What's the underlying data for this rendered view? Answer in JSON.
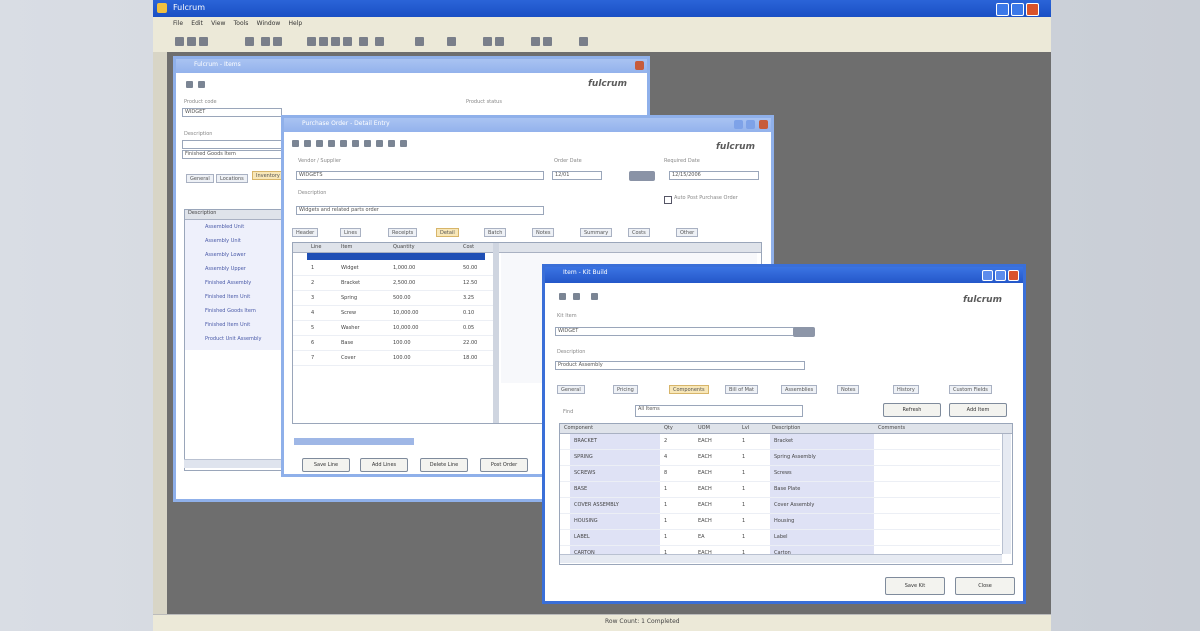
{
  "app": {
    "title": "Fulcrum",
    "menu": [
      "File",
      "Edit",
      "View",
      "Tools",
      "Window",
      "Help"
    ],
    "status": "Row Count: 1 Completed"
  },
  "window1": {
    "title": "Fulcrum - Items",
    "logo": "fulcrum",
    "labels": [
      "Product code",
      "Description",
      "Product status"
    ],
    "field_values": [
      "WIDGET",
      "",
      "Finished Goods Item"
    ],
    "tabs": [
      "General",
      "Locations",
      "Inventory"
    ],
    "list_header": "Description",
    "list_items": [
      "Assembled Unit",
      "Assembly Unit",
      "Assembly Lower",
      "Assembly Upper",
      "Finished Assembly",
      "Finished Item Unit",
      "Finished Goods Item",
      "Finished Item Unit",
      "Product Unit Assembly"
    ]
  },
  "window2": {
    "title": "Purchase Order - Detail Entry",
    "logo": "fulcrum",
    "labels": [
      "Vendor / Supplier",
      "Order Date",
      "Required Date",
      "Description"
    ],
    "field_values": [
      "WIDGETS",
      "12/01",
      "12/15/2006",
      "Widgets and related parts order"
    ],
    "checkbox": "Auto Post Purchase Order",
    "tabs": [
      "Header",
      "Lines",
      "Receipts",
      "Detail",
      "Batch",
      "Notes",
      "Summary",
      "Costs",
      "Other"
    ],
    "columns": [
      "Line",
      "Item",
      "Quantity",
      "Cost"
    ],
    "rows": [
      [
        "1",
        "Widget",
        "1,000.00",
        "50.00"
      ],
      [
        "2",
        "Bracket",
        "2,500.00",
        "12.50"
      ],
      [
        "3",
        "Spring",
        "500.00",
        "3.25"
      ],
      [
        "4",
        "Screw",
        "10,000.00",
        "0.10"
      ],
      [
        "5",
        "Washer",
        "10,000.00",
        "0.05"
      ],
      [
        "6",
        "Base",
        "100.00",
        "22.00"
      ],
      [
        "7",
        "Cover",
        "100.00",
        "18.00"
      ]
    ],
    "buttons": [
      "Save Line",
      "Add Lines",
      "Delete Line",
      "Post Order"
    ]
  },
  "window3": {
    "title": "Item - Kit Build",
    "logo": "fulcrum",
    "labels": [
      "Kit Item",
      "Description"
    ],
    "field_values": [
      "WIDGET",
      "Product Assembly"
    ],
    "tabs": [
      "General",
      "Pricing",
      "Components",
      "Bill of Mat",
      "Assemblies",
      "Notes",
      "History",
      "Custom Fields"
    ],
    "filter_label": "Find",
    "filter_value": "All Items",
    "filter_buttons": [
      "Refresh",
      "Add Item"
    ],
    "columns": [
      "Component",
      "Qty",
      "UOM",
      "Lvl",
      "Description",
      "Comments"
    ],
    "rows": [
      [
        "BRACKET",
        "2",
        "EACH",
        "1",
        "Bracket"
      ],
      [
        "SPRING",
        "4",
        "EACH",
        "1",
        "Spring Assembly"
      ],
      [
        "SCREWS",
        "8",
        "EACH",
        "1",
        "Screws"
      ],
      [
        "BASE",
        "1",
        "EACH",
        "1",
        "Base Plate"
      ],
      [
        "COVER ASSEMBLY",
        "1",
        "EACH",
        "1",
        "Cover Assembly"
      ],
      [
        "HOUSING",
        "1",
        "EACH",
        "1",
        "Housing"
      ],
      [
        "LABEL",
        "1",
        "EA",
        "1",
        "Label"
      ],
      [
        "CARTON",
        "1",
        "EACH",
        "1",
        "Carton"
      ]
    ],
    "buttons": [
      "Save Kit",
      "Close"
    ]
  }
}
